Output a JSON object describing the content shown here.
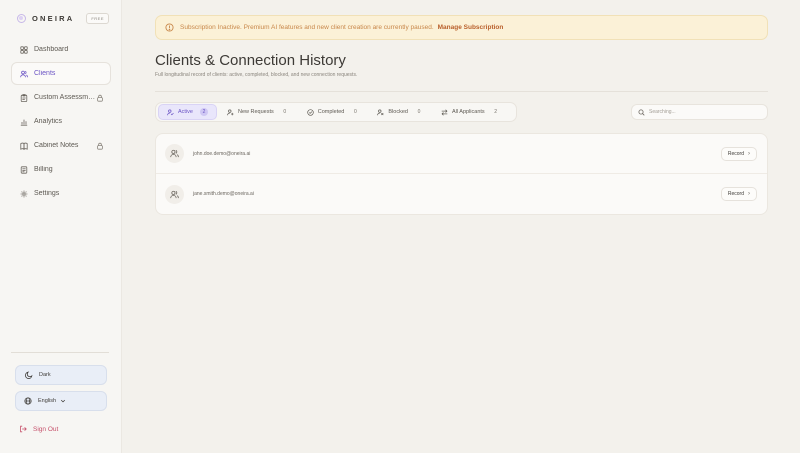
{
  "brand": {
    "name": "ONEIRA",
    "plan_badge": "FREE"
  },
  "sidebar": {
    "items": [
      {
        "label": "Dashboard",
        "icon": "grid-icon",
        "active": false,
        "locked": false
      },
      {
        "label": "Clients",
        "icon": "users-icon",
        "active": true,
        "locked": false
      },
      {
        "label": "Custom Assessm…",
        "icon": "clipboard-icon",
        "active": false,
        "locked": true
      },
      {
        "label": "Analytics",
        "icon": "bar-chart-icon",
        "active": false,
        "locked": false
      },
      {
        "label": "Cabinet Notes",
        "icon": "book-icon",
        "active": false,
        "locked": true
      },
      {
        "label": "Billing",
        "icon": "credit-card-icon",
        "active": false,
        "locked": false
      },
      {
        "label": "Settings",
        "icon": "gear-icon",
        "active": false,
        "locked": false
      }
    ],
    "theme_label": "Dark",
    "language_label": "English",
    "signout_label": "Sign Out"
  },
  "banner": {
    "text": "Subscription Inactive. Premium AI features and new client creation are currently paused.",
    "link": "Manage Subscription"
  },
  "page": {
    "title": "Clients & Connection History",
    "subtitle": "Full longitudinal record of clients: active, completed, blocked, and new connection requests."
  },
  "tabs": [
    {
      "label": "Active",
      "count": "2",
      "active": true,
      "icon": "user-check-icon"
    },
    {
      "label": "New Requests",
      "count": "0",
      "active": false,
      "icon": "user-plus-icon"
    },
    {
      "label": "Completed",
      "count": "0",
      "active": false,
      "icon": "check-circle-icon"
    },
    {
      "label": "Blocked",
      "count": "0",
      "active": false,
      "icon": "user-x-icon"
    },
    {
      "label": "All Applicants",
      "count": "2",
      "active": false,
      "icon": "swap-icon"
    }
  ],
  "search": {
    "placeholder": "Searching..."
  },
  "clients": [
    {
      "email": "john.doe.demo@oneira.ai",
      "action": "Record"
    },
    {
      "email": "jane.smith.demo@oneira.ai",
      "action": "Record"
    }
  ],
  "colors": {
    "accent": "#6a53c4",
    "warning_bg": "#fbf1d7",
    "warning_text": "#c8874a",
    "danger": "#c6506a"
  }
}
